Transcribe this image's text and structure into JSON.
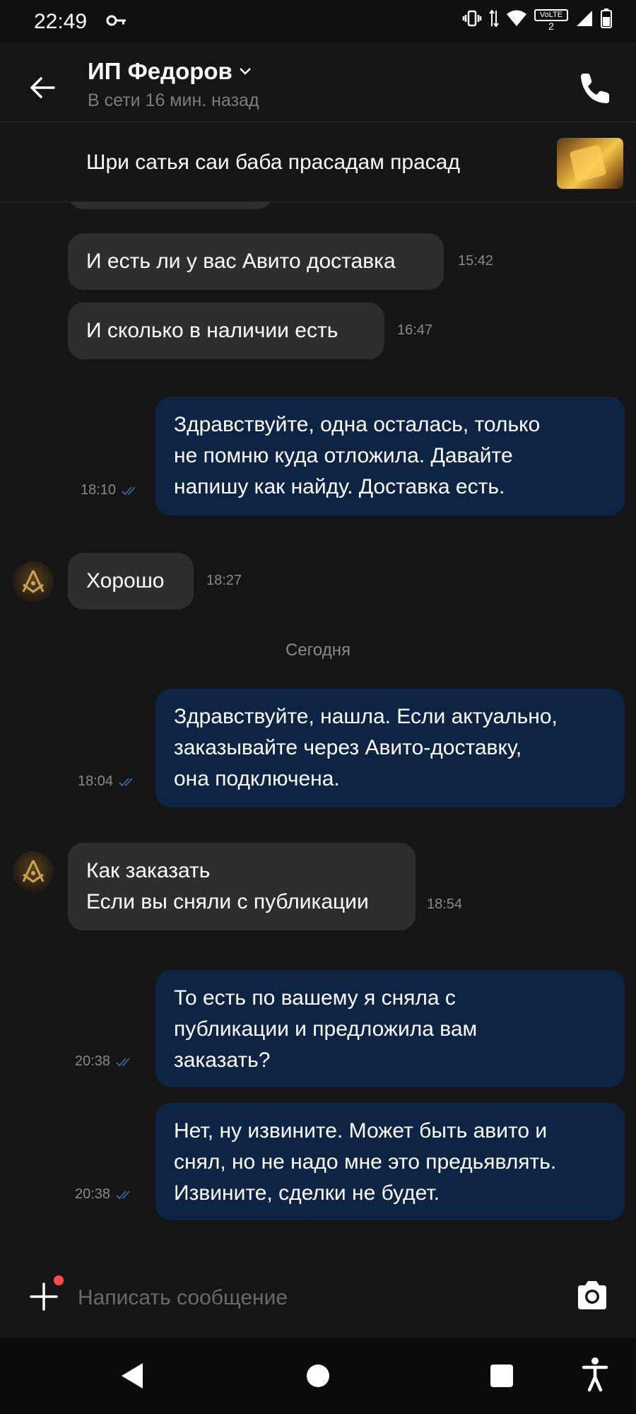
{
  "status_bar": {
    "time": "22:49",
    "volte_label": "VoLTE",
    "sim_number": "2"
  },
  "header": {
    "contact_name": "ИП Федоров",
    "contact_status": "В сети 16 мин. назад"
  },
  "listing": {
    "title": "Шри сатья саи баба прасадам прасад"
  },
  "messages": [
    {
      "direction": "in",
      "lines": [
        "И есть ли у вас Авито доставка"
      ],
      "time": "15:42"
    },
    {
      "direction": "in",
      "lines": [
        "И сколько в наличии есть"
      ],
      "time": "16:47"
    },
    {
      "direction": "out",
      "lines": [
        "Здравствуйте, одна осталась, только",
        "не помню куда отложила. Давайте",
        "напишу как найду. Доставка есть."
      ],
      "time": "18:10",
      "read": true
    },
    {
      "direction": "in",
      "lines": [
        "Хорошо"
      ],
      "time": "18:27",
      "avatar": true
    },
    {
      "direction": "out",
      "lines": [
        "Здравствуйте, нашла. Если актуально,",
        "заказывайте через Авито-доставку,",
        "она подключена."
      ],
      "time": "18:04",
      "read": true
    },
    {
      "direction": "in",
      "lines": [
        "Как заказать",
        "Если вы сняли с публикации"
      ],
      "time": "18:54",
      "avatar": true
    },
    {
      "direction": "out",
      "lines": [
        "То есть по вашему я сняла с",
        "публикации и предложила вам",
        "заказать?"
      ],
      "time": "20:38",
      "read": true
    },
    {
      "direction": "out",
      "lines": [
        "Нет, ну извините. Может быть авито и",
        "снял, но не надо мне это предьявлять.",
        "Извините, сделки не будет."
      ],
      "time": "20:38",
      "read": true
    }
  ],
  "date_separator": "Сегодня",
  "input": {
    "placeholder": "Написать сообщение"
  },
  "colors": {
    "background": "#161616",
    "incoming_bubble": "#2e2e2e",
    "outgoing_bubble": "#0d2444",
    "read_check": "#3a6fb5",
    "notification_dot": "#ff4b4b"
  }
}
